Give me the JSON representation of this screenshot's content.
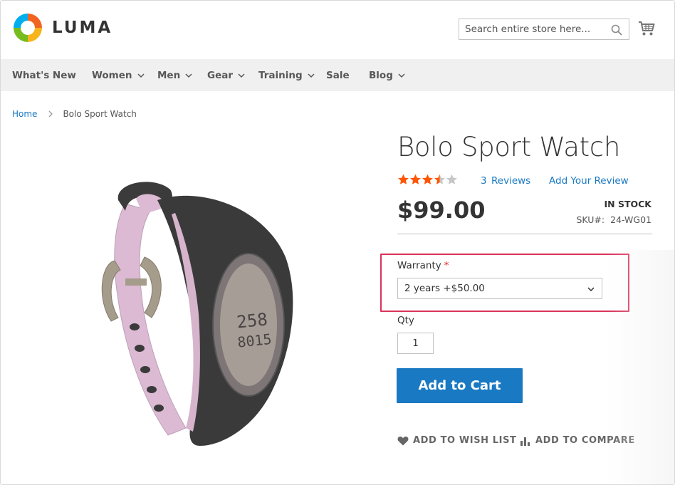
{
  "header": {
    "logo_text": "LUMA",
    "search_placeholder": "Search entire store here..."
  },
  "nav": {
    "items": [
      {
        "label": "What's New",
        "has_dropdown": false
      },
      {
        "label": "Women",
        "has_dropdown": true
      },
      {
        "label": "Men",
        "has_dropdown": true
      },
      {
        "label": "Gear",
        "has_dropdown": true
      },
      {
        "label": "Training",
        "has_dropdown": true
      },
      {
        "label": "Sale",
        "has_dropdown": false
      },
      {
        "label": "Blog",
        "has_dropdown": true
      }
    ]
  },
  "breadcrumb": {
    "home": "Home",
    "current": "Bolo Sport Watch"
  },
  "product": {
    "title": "Bolo Sport Watch",
    "rating_stars": 3.5,
    "rating_max": 5,
    "reviews_count": "3",
    "reviews_word": "Reviews",
    "add_review": "Add Your Review",
    "price": "$99.00",
    "stock": "IN STOCK",
    "sku_label": "SKU#:",
    "sku_value": "24-WG01",
    "warranty_label": "Warranty",
    "required_mark": "*",
    "warranty_selected": "2 years +$50.00",
    "qty_label": "Qty",
    "qty_value": "1",
    "add_to_cart": "Add to Cart",
    "wishlist": "ADD TO WISH LIST",
    "compare": "ADD TO COMPARE"
  },
  "colors": {
    "link_blue": "#1979c3",
    "star_orange": "#ff5501",
    "star_empty": "#c7c7c7",
    "highlight_red": "#d9335a",
    "nav_bg": "#f0f0f0"
  }
}
